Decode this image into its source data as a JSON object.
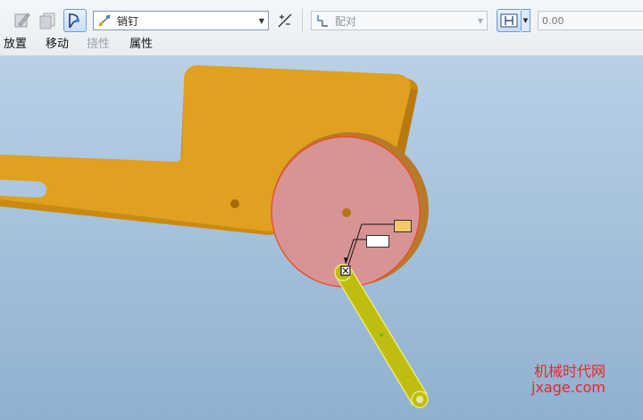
{
  "toolbar": {
    "connection_type": {
      "value": "销钉"
    },
    "constraint": {
      "value": "配对"
    },
    "offset_input": {
      "placeholder": "0.00"
    }
  },
  "tabs": [
    {
      "label": "放置"
    },
    {
      "label": "移动"
    },
    {
      "label": "挠性"
    },
    {
      "label": "属性"
    }
  ],
  "watermark": {
    "line1": "机械时代网",
    "line2": "jxage.com"
  },
  "colors": {
    "part_orange": "#e0a020",
    "disc_pink": "#d89494",
    "link_yellow": "#bfbd10",
    "accent_blue": "#3f82c8"
  }
}
